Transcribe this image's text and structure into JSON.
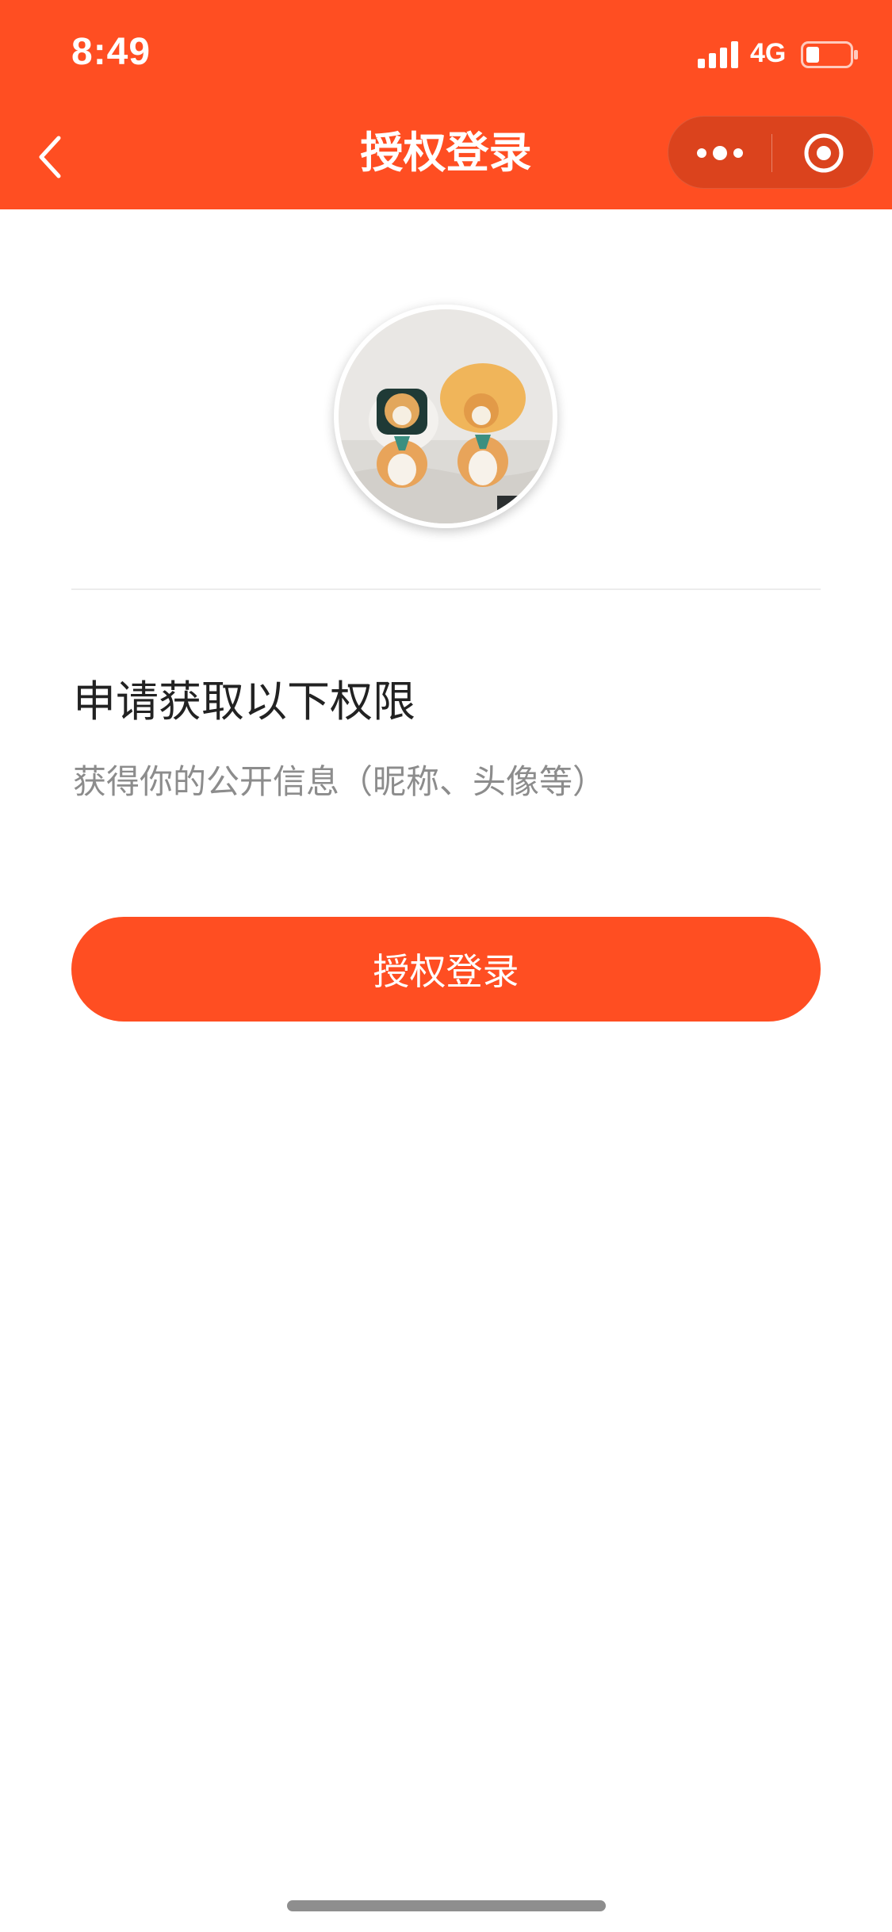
{
  "status_bar": {
    "time": "8:49",
    "network": "4G"
  },
  "nav": {
    "title": "授权登录",
    "back_icon": "chevron-left-icon",
    "more_icon": "more-dots-icon",
    "close_icon": "close-circle-icon"
  },
  "colors": {
    "brand": "#FF4E22",
    "text_primary": "#222222",
    "text_secondary": "#8c8c8c"
  },
  "permissions": {
    "title": "申请获取以下权限",
    "description": "获得你的公开信息（昵称、头像等）"
  },
  "actions": {
    "authorize_label": "授权登录"
  }
}
